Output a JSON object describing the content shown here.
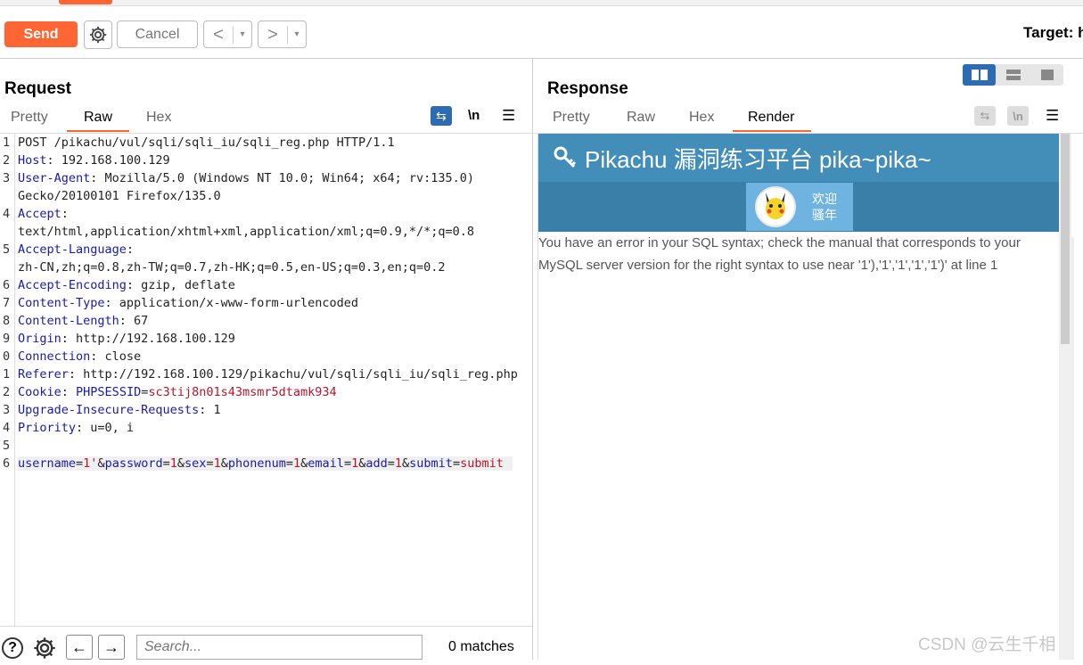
{
  "toolbar": {
    "send_label": "Send",
    "cancel_label": "Cancel",
    "back_glyph": "<",
    "forward_glyph": ">",
    "dropdown_glyph": "▾",
    "target_label": "Target: h"
  },
  "request": {
    "title": "Request",
    "tabs": [
      "Pretty",
      "Raw",
      "Hex"
    ],
    "active_tab": "Raw",
    "wrap_icon_glyph": "⇆",
    "newline_toggle": "\\n",
    "menu_glyph": "☰",
    "line_numbers": [
      "1",
      "2",
      "3",
      "",
      "4",
      "",
      "5",
      "",
      "6",
      "7",
      "8",
      "9",
      "0",
      "1",
      "2",
      "3",
      "4",
      "5",
      "6"
    ],
    "lines": [
      {
        "plain": "POST /pikachu/vul/sqli/sqli_iu/sqli_reg.php HTTP/1.1"
      },
      {
        "key": "Host",
        "rest": ": 192.168.100.129"
      },
      {
        "key": "User-Agent",
        "rest": ": Mozilla/5.0 (Windows NT 10.0; Win64; x64; rv:135.0)"
      },
      {
        "plain": "Gecko/20100101 Firefox/135.0"
      },
      {
        "key": "Accept",
        "rest": ":"
      },
      {
        "plain": "text/html,application/xhtml+xml,application/xml;q=0.9,*/*;q=0.8"
      },
      {
        "key": "Accept-Language",
        "rest": ":"
      },
      {
        "plain": "zh-CN,zh;q=0.8,zh-TW;q=0.7,zh-HK;q=0.5,en-US;q=0.3,en;q=0.2"
      },
      {
        "key": "Accept-Encoding",
        "rest": ": gzip, deflate"
      },
      {
        "key": "Content-Type",
        "rest": ": application/x-www-form-urlencoded"
      },
      {
        "key": "Content-Length",
        "rest": ": 67"
      },
      {
        "key": "Origin",
        "rest": ": http://192.168.100.129"
      },
      {
        "key": "Connection",
        "rest": ": close"
      },
      {
        "key": "Referer",
        "rest": ": http://192.168.100.129/pikachu/vul/sqli/sqli_iu/sqli_reg.php"
      },
      {
        "cookie_key": "Cookie",
        "cookie_name": "PHPSESSID",
        "cookie_value": "sc3tij8n01s43msmr5dtamk934"
      },
      {
        "key": "Upgrade-Insecure-Requests",
        "rest": ": 1"
      },
      {
        "key": "Priority",
        "rest": ": u=0, i"
      },
      {
        "plain": ""
      }
    ],
    "body_params": [
      {
        "k": "username",
        "v": "1'"
      },
      {
        "k": "password",
        "v": "1"
      },
      {
        "k": "sex",
        "v": "1"
      },
      {
        "k": "phonenum",
        "v": "1"
      },
      {
        "k": "email",
        "v": "1"
      },
      {
        "k": "add",
        "v": "1"
      },
      {
        "k": "submit",
        "v": "submit"
      }
    ]
  },
  "search": {
    "help_glyph": "?",
    "prev_glyph": "←",
    "next_glyph": "→",
    "placeholder": "Search...",
    "matches": "0 matches"
  },
  "response": {
    "title": "Response",
    "tabs": [
      "Pretty",
      "Raw",
      "Hex",
      "Render"
    ],
    "active_tab": "Render",
    "wrap_icon_glyph": "⇆",
    "newline_toggle": "\\n",
    "menu_glyph": "☰",
    "render": {
      "site_title": "Pikachu 漏洞练习平台 pika~pika~",
      "welcome_line1": "欢迎",
      "welcome_line2": "骚年",
      "error_message": "You have an error in your SQL syntax; check the manual that corresponds to your MySQL server version for the right syntax to use near '1'),'1','1','1','1')' at line 1"
    }
  },
  "watermark": "CSDN @云生千相",
  "colors": {
    "accent": "#ff6633",
    "header_key": "#1a1aa6",
    "cookie_value": "#b5172e",
    "render_header": "#438eb9",
    "render_nav": "#3a7fa8",
    "view_active": "#2d6bb3"
  }
}
